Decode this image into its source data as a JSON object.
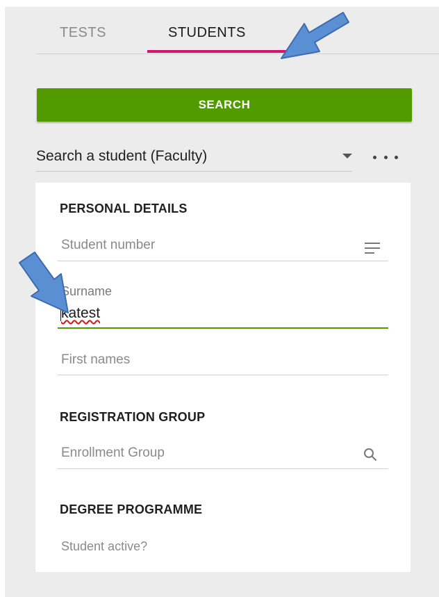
{
  "tabs": [
    {
      "label": "TESTS",
      "active": false
    },
    {
      "label": "STUDENTS",
      "active": true
    }
  ],
  "search_button": {
    "label": "SEARCH"
  },
  "scope_select": {
    "value": "Search a student (Faculty)"
  },
  "personal_details": {
    "title": "PERSONAL DETAILS",
    "student_number_placeholder": "Student number",
    "surname_label": "Surname",
    "surname_value": "katest",
    "first_names_placeholder": "First names"
  },
  "registration_group": {
    "title": "REGISTRATION GROUP",
    "enrollment_placeholder": "Enrollment Group"
  },
  "degree_programme": {
    "title": "DEGREE PROGRAMME",
    "student_active_label": "Student active?"
  },
  "colors": {
    "accent_green": "#519a00",
    "tab_indicator": "#d6136f",
    "annotation_arrow": "#5b8fd4"
  },
  "icons": {
    "list": "list-icon",
    "search": "search-icon",
    "more": "more-horizontal-icon",
    "dropdown": "dropdown-arrow-icon"
  }
}
